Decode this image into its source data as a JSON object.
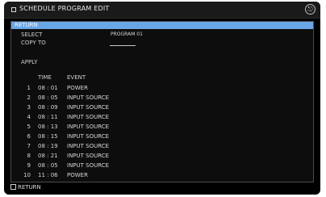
{
  "window": {
    "title": "SCHEDULE PROGRAM EDIT",
    "close_glyph": "⎋"
  },
  "menu": {
    "return_label": "RETURN",
    "select_label": "SELECT",
    "select_value": "PROGRAM 01",
    "copy_label": "COPY TO",
    "apply_label": "APPLY"
  },
  "table": {
    "headers": {
      "time": "TIME",
      "event": "EVENT"
    },
    "rows": [
      {
        "num": "1",
        "time": "08 : 01",
        "event": "POWER"
      },
      {
        "num": "2",
        "time": "08 : 05",
        "event": "INPUT SOURCE"
      },
      {
        "num": "3",
        "time": "08 : 09",
        "event": "INPUT SOURCE"
      },
      {
        "num": "4",
        "time": "08 : 11",
        "event": "INPUT SOURCE"
      },
      {
        "num": "5",
        "time": "08 : 13",
        "event": "INPUT SOURCE"
      },
      {
        "num": "6",
        "time": "08 : 15",
        "event": "INPUT SOURCE"
      },
      {
        "num": "7",
        "time": "08 : 19",
        "event": "INPUT SOURCE"
      },
      {
        "num": "8",
        "time": "08 : 21",
        "event": "INPUT SOURCE"
      },
      {
        "num": "9",
        "time": "08 : 05",
        "event": "INPUT SOURCE"
      },
      {
        "num": "10",
        "time": "11 : 06",
        "event": "POWER"
      }
    ]
  },
  "footer": {
    "return_label": "RETURN"
  },
  "colors": {
    "accent": "#6aa6e6",
    "background": "#000000",
    "text": "#d6d6d6"
  }
}
